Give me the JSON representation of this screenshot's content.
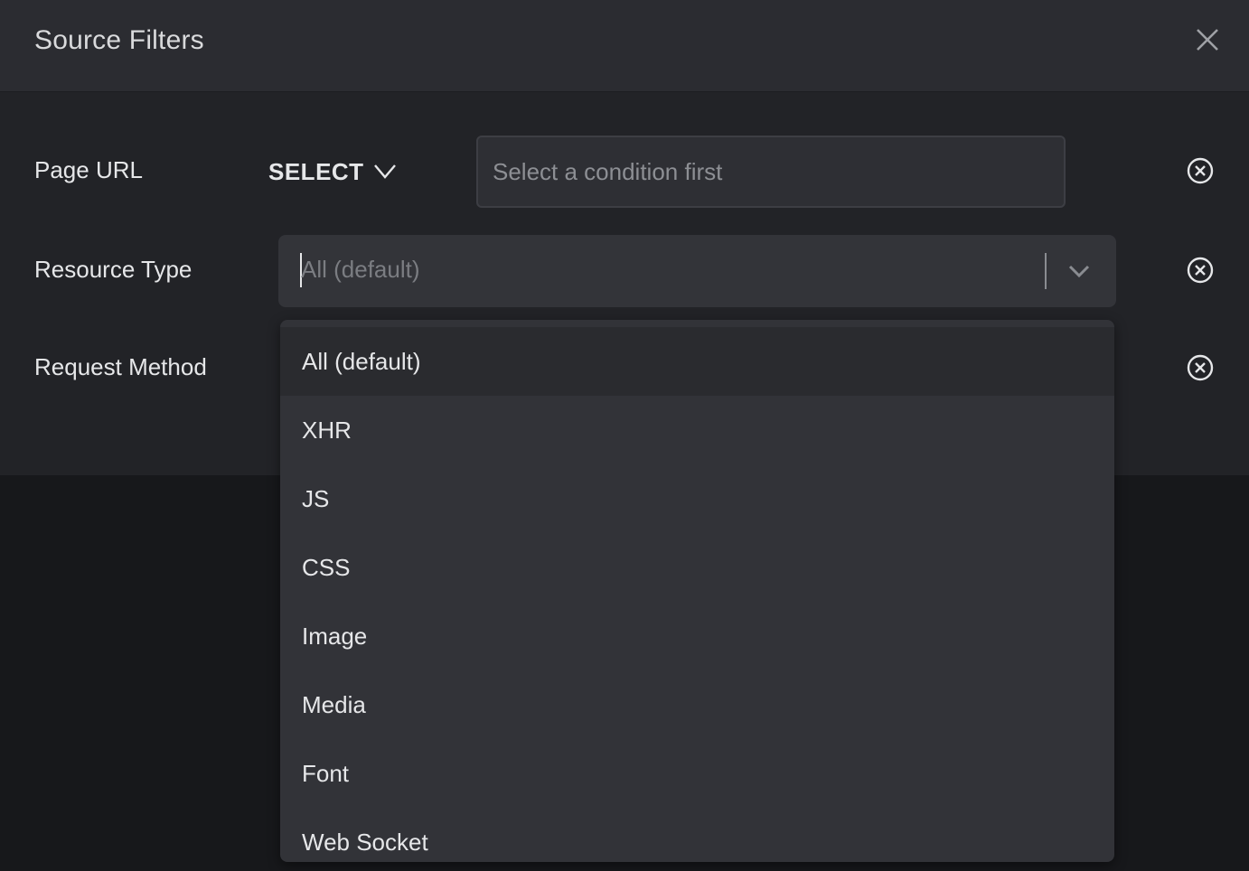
{
  "dialog": {
    "title": "Source Filters",
    "close_icon": "close-icon"
  },
  "rows": {
    "page_url": {
      "label": "Page URL",
      "condition_label": "SELECT",
      "value_placeholder": "Select a condition first"
    },
    "resource_type": {
      "label": "Resource Type",
      "placeholder": "All (default)"
    },
    "request_method": {
      "label": "Request Method"
    }
  },
  "dropdown": {
    "options": [
      {
        "label": "All (default)",
        "highlighted": true
      },
      {
        "label": "XHR"
      },
      {
        "label": "JS"
      },
      {
        "label": "CSS"
      },
      {
        "label": "Image"
      },
      {
        "label": "Media"
      },
      {
        "label": "Font"
      },
      {
        "label": "Web Socket"
      }
    ]
  },
  "colors": {
    "header_bg": "#2b2c31",
    "body_bg": "#222327",
    "backdrop": "#17181b",
    "text": "#e6e7e9",
    "muted_text": "#8d8f94",
    "dropdown_bg": "#323338",
    "highlight_bg": "#2a2b2f"
  }
}
